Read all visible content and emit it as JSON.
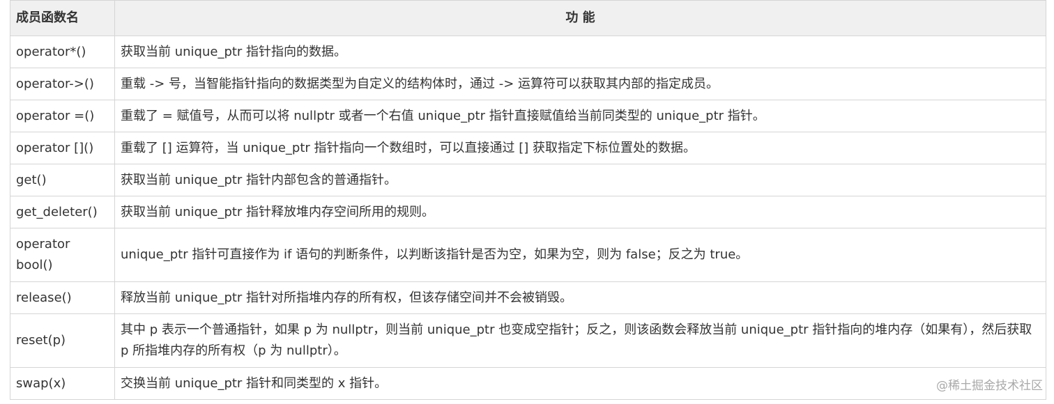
{
  "table": {
    "headers": [
      "成员函数名",
      "功 能"
    ],
    "rows": [
      {
        "name": "operator*()",
        "desc": "获取当前 unique_ptr 指针指向的数据。"
      },
      {
        "name": "operator->()",
        "desc": "重载 -> 号，当智能指针指向的数据类型为自定义的结构体时，通过 -> 运算符可以获取其内部的指定成员。"
      },
      {
        "name": "operator =()",
        "desc": "重载了 = 赋值号，从而可以将 nullptr 或者一个右值 unique_ptr 指针直接赋值给当前同类型的 unique_ptr 指针。"
      },
      {
        "name": "operator []()",
        "desc": "重载了 [] 运算符，当 unique_ptr 指针指向一个数组时，可以直接通过 [] 获取指定下标位置处的数据。"
      },
      {
        "name": "get()",
        "desc": "获取当前 unique_ptr 指针内部包含的普通指针。"
      },
      {
        "name": "get_deleter()",
        "desc": "获取当前 unique_ptr 指针释放堆内存空间所用的规则。"
      },
      {
        "name": "operator bool()",
        "desc": "unique_ptr 指针可直接作为 if 语句的判断条件，以判断该指针是否为空，如果为空，则为 false；反之为 true。"
      },
      {
        "name": "release()",
        "desc": "释放当前 unique_ptr 指针对所指堆内存的所有权，但该存储空间并不会被销毁。"
      },
      {
        "name": "reset(p)",
        "desc": "其中 p 表示一个普通指针，如果 p 为 nullptr，则当前 unique_ptr 也变成空指针；反之，则该函数会释放当前 unique_ptr 指针指向的堆内存（如果有），然后获取 p 所指堆内存的所有权（p 为 nullptr）。"
      },
      {
        "name": "swap(x)",
        "desc": "交换当前 unique_ptr 指针和同类型的 x 指针。"
      }
    ]
  },
  "watermark": "@稀土掘金技术社区"
}
